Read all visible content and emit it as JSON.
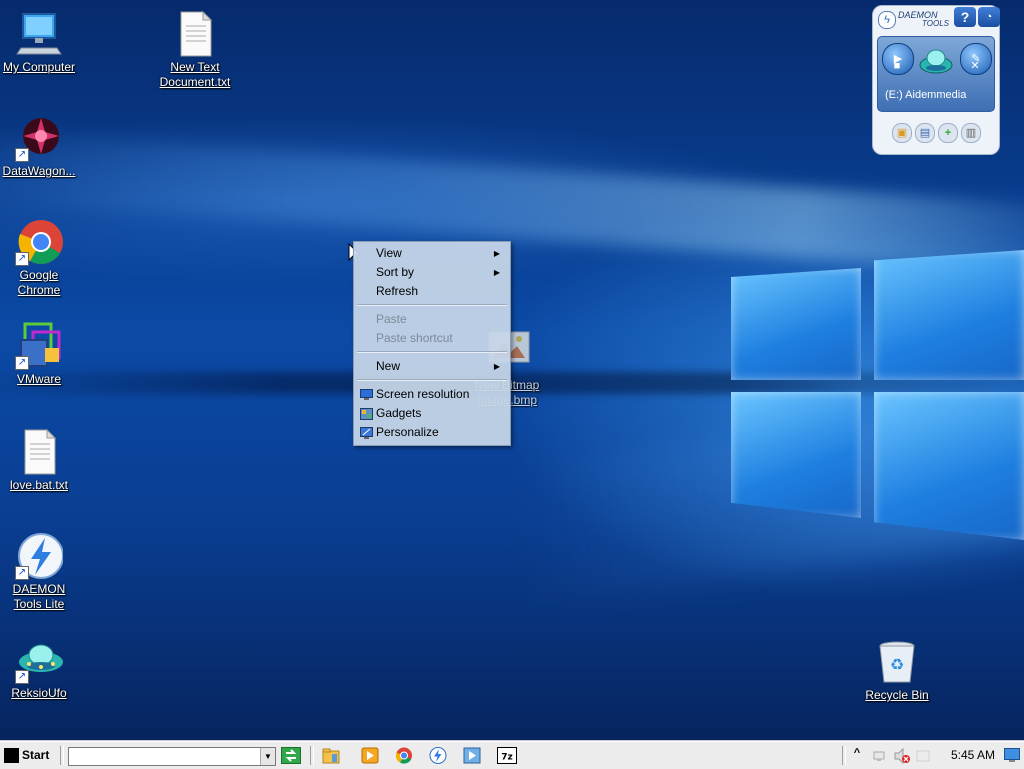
{
  "desktop": {
    "icons": [
      {
        "id": "my-computer",
        "label1": "My Computer",
        "label2": ""
      },
      {
        "id": "new-text-document",
        "label1": "New Text",
        "label2": "Document.txt"
      },
      {
        "id": "datawagon",
        "label1": "DataWagon...",
        "label2": ""
      },
      {
        "id": "google-chrome",
        "label1": "Google",
        "label2": "Chrome"
      },
      {
        "id": "vmware",
        "label1": "VMware",
        "label2": ""
      },
      {
        "id": "love-bat",
        "label1": "love.bat.txt",
        "label2": ""
      },
      {
        "id": "daemon-tools-lite",
        "label1": "DAEMON",
        "label2": "Tools Lite"
      },
      {
        "id": "reksioufo",
        "label1": "ReksioUfo",
        "label2": ""
      },
      {
        "id": "new-bitmap",
        "label1": "New Bitmap",
        "label2": "Image.bmp"
      },
      {
        "id": "recycle-bin",
        "label1": "Recycle Bin",
        "label2": ""
      }
    ]
  },
  "context_menu": {
    "view": "View",
    "sort_by": "Sort by",
    "refresh": "Refresh",
    "paste": "Paste",
    "paste_shortcut": "Paste shortcut",
    "new": "New",
    "screen_resolution": "Screen resolution",
    "gadgets": "Gadgets",
    "personalize": "Personalize"
  },
  "daemon_gadget": {
    "logo_line1": "DAEMON",
    "logo_line2": "TOOLS",
    "drive_label": "(E:) Aidemmedia",
    "help_symbol": "?"
  },
  "taskbar": {
    "start_label": "Start",
    "address_value": "",
    "clock": "5:45 AM",
    "tray_expand": "^"
  },
  "colors": {
    "desktop_blue": "#0b4aa6",
    "taskbar": "#ececec",
    "menu_bg": "#c6d6e8"
  }
}
